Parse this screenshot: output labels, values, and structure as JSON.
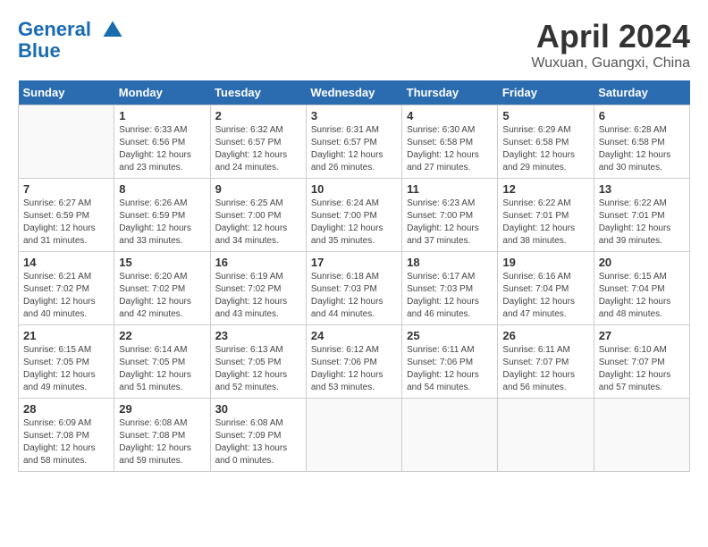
{
  "header": {
    "logo_line1": "General",
    "logo_line2": "Blue",
    "title": "April 2024",
    "location": "Wuxuan, Guangxi, China"
  },
  "weekdays": [
    "Sunday",
    "Monday",
    "Tuesday",
    "Wednesday",
    "Thursday",
    "Friday",
    "Saturday"
  ],
  "weeks": [
    [
      {
        "day": "",
        "info": ""
      },
      {
        "day": "1",
        "info": "Sunrise: 6:33 AM\nSunset: 6:56 PM\nDaylight: 12 hours\nand 23 minutes."
      },
      {
        "day": "2",
        "info": "Sunrise: 6:32 AM\nSunset: 6:57 PM\nDaylight: 12 hours\nand 24 minutes."
      },
      {
        "day": "3",
        "info": "Sunrise: 6:31 AM\nSunset: 6:57 PM\nDaylight: 12 hours\nand 26 minutes."
      },
      {
        "day": "4",
        "info": "Sunrise: 6:30 AM\nSunset: 6:58 PM\nDaylight: 12 hours\nand 27 minutes."
      },
      {
        "day": "5",
        "info": "Sunrise: 6:29 AM\nSunset: 6:58 PM\nDaylight: 12 hours\nand 29 minutes."
      },
      {
        "day": "6",
        "info": "Sunrise: 6:28 AM\nSunset: 6:58 PM\nDaylight: 12 hours\nand 30 minutes."
      }
    ],
    [
      {
        "day": "7",
        "info": "Sunrise: 6:27 AM\nSunset: 6:59 PM\nDaylight: 12 hours\nand 31 minutes."
      },
      {
        "day": "8",
        "info": "Sunrise: 6:26 AM\nSunset: 6:59 PM\nDaylight: 12 hours\nand 33 minutes."
      },
      {
        "day": "9",
        "info": "Sunrise: 6:25 AM\nSunset: 7:00 PM\nDaylight: 12 hours\nand 34 minutes."
      },
      {
        "day": "10",
        "info": "Sunrise: 6:24 AM\nSunset: 7:00 PM\nDaylight: 12 hours\nand 35 minutes."
      },
      {
        "day": "11",
        "info": "Sunrise: 6:23 AM\nSunset: 7:00 PM\nDaylight: 12 hours\nand 37 minutes."
      },
      {
        "day": "12",
        "info": "Sunrise: 6:22 AM\nSunset: 7:01 PM\nDaylight: 12 hours\nand 38 minutes."
      },
      {
        "day": "13",
        "info": "Sunrise: 6:22 AM\nSunset: 7:01 PM\nDaylight: 12 hours\nand 39 minutes."
      }
    ],
    [
      {
        "day": "14",
        "info": "Sunrise: 6:21 AM\nSunset: 7:02 PM\nDaylight: 12 hours\nand 40 minutes."
      },
      {
        "day": "15",
        "info": "Sunrise: 6:20 AM\nSunset: 7:02 PM\nDaylight: 12 hours\nand 42 minutes."
      },
      {
        "day": "16",
        "info": "Sunrise: 6:19 AM\nSunset: 7:02 PM\nDaylight: 12 hours\nand 43 minutes."
      },
      {
        "day": "17",
        "info": "Sunrise: 6:18 AM\nSunset: 7:03 PM\nDaylight: 12 hours\nand 44 minutes."
      },
      {
        "day": "18",
        "info": "Sunrise: 6:17 AM\nSunset: 7:03 PM\nDaylight: 12 hours\nand 46 minutes."
      },
      {
        "day": "19",
        "info": "Sunrise: 6:16 AM\nSunset: 7:04 PM\nDaylight: 12 hours\nand 47 minutes."
      },
      {
        "day": "20",
        "info": "Sunrise: 6:15 AM\nSunset: 7:04 PM\nDaylight: 12 hours\nand 48 minutes."
      }
    ],
    [
      {
        "day": "21",
        "info": "Sunrise: 6:15 AM\nSunset: 7:05 PM\nDaylight: 12 hours\nand 49 minutes."
      },
      {
        "day": "22",
        "info": "Sunrise: 6:14 AM\nSunset: 7:05 PM\nDaylight: 12 hours\nand 51 minutes."
      },
      {
        "day": "23",
        "info": "Sunrise: 6:13 AM\nSunset: 7:05 PM\nDaylight: 12 hours\nand 52 minutes."
      },
      {
        "day": "24",
        "info": "Sunrise: 6:12 AM\nSunset: 7:06 PM\nDaylight: 12 hours\nand 53 minutes."
      },
      {
        "day": "25",
        "info": "Sunrise: 6:11 AM\nSunset: 7:06 PM\nDaylight: 12 hours\nand 54 minutes."
      },
      {
        "day": "26",
        "info": "Sunrise: 6:11 AM\nSunset: 7:07 PM\nDaylight: 12 hours\nand 56 minutes."
      },
      {
        "day": "27",
        "info": "Sunrise: 6:10 AM\nSunset: 7:07 PM\nDaylight: 12 hours\nand 57 minutes."
      }
    ],
    [
      {
        "day": "28",
        "info": "Sunrise: 6:09 AM\nSunset: 7:08 PM\nDaylight: 12 hours\nand 58 minutes."
      },
      {
        "day": "29",
        "info": "Sunrise: 6:08 AM\nSunset: 7:08 PM\nDaylight: 12 hours\nand 59 minutes."
      },
      {
        "day": "30",
        "info": "Sunrise: 6:08 AM\nSunset: 7:09 PM\nDaylight: 13 hours\nand 0 minutes."
      },
      {
        "day": "",
        "info": ""
      },
      {
        "day": "",
        "info": ""
      },
      {
        "day": "",
        "info": ""
      },
      {
        "day": "",
        "info": ""
      }
    ]
  ]
}
